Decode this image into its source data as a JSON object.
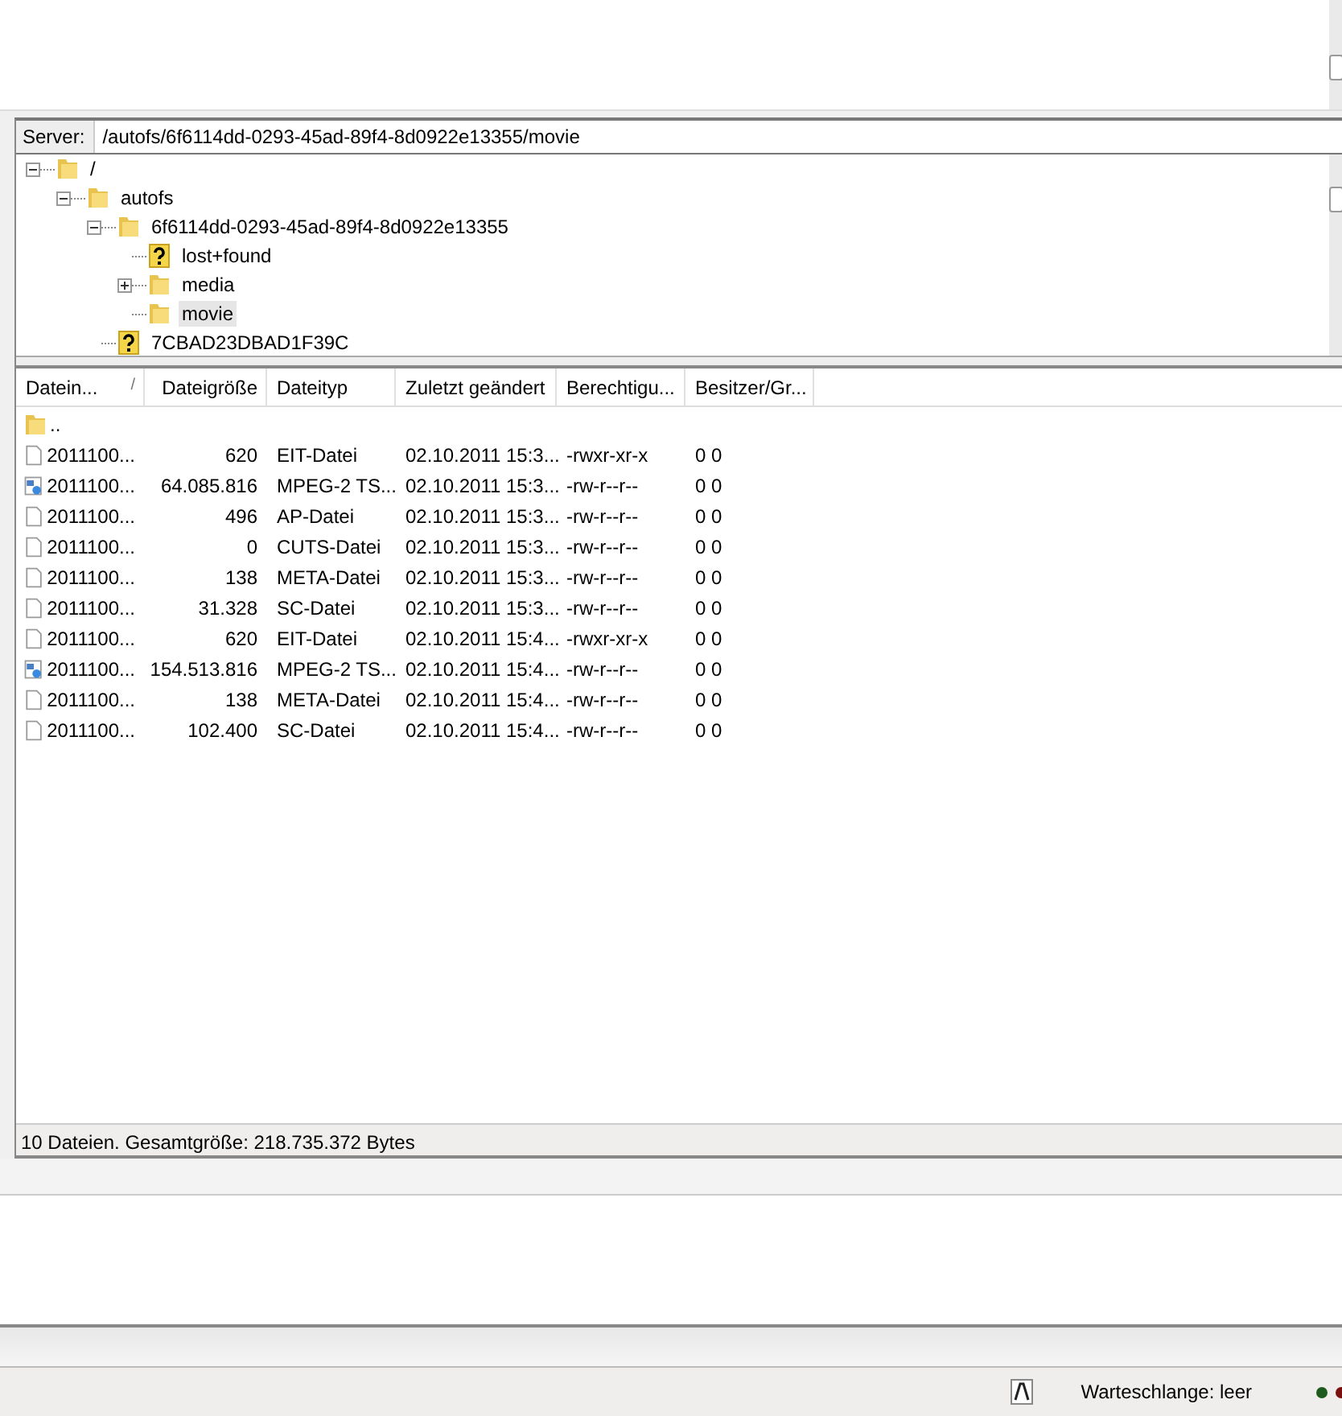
{
  "server_bar": {
    "label": "Server:",
    "path": "/autofs/6f6114dd-0293-45ad-89f4-8d0922e13355/movie"
  },
  "tree": [
    {
      "label": "/",
      "kind": "folder",
      "expanded": true,
      "selected": false,
      "children": [
        {
          "label": "autofs",
          "kind": "folder",
          "expanded": true,
          "selected": false,
          "children": [
            {
              "label": "6f6114dd-0293-45ad-89f4-8d0922e13355",
              "kind": "folder",
              "expanded": true,
              "selected": false,
              "children": [
                {
                  "label": "lost+found",
                  "kind": "unknown",
                  "selected": false
                },
                {
                  "label": "media",
                  "kind": "folder",
                  "expanded": false,
                  "selected": false
                },
                {
                  "label": "movie",
                  "kind": "folder",
                  "selected": true
                }
              ]
            },
            {
              "label": "7CBAD23DBAD1F39C",
              "kind": "unknown",
              "selected": false
            }
          ]
        }
      ]
    }
  ],
  "table": {
    "columns": [
      {
        "label": "Datein...",
        "sort": "/"
      },
      {
        "label": "Dateigröße"
      },
      {
        "label": "Dateityp"
      },
      {
        "label": "Zuletzt geändert"
      },
      {
        "label": "Berechtigu..."
      },
      {
        "label": "Besitzer/Gr..."
      }
    ],
    "rows": [
      {
        "kind": "folder",
        "cells": [
          ".."
        ]
      },
      {
        "kind": "file",
        "cells": [
          "2011100...",
          "620",
          "EIT-Datei",
          "02.10.2011 15:3...",
          "-rwxr-xr-x",
          "0 0"
        ]
      },
      {
        "kind": "video",
        "cells": [
          "2011100...",
          "64.085.816",
          "MPEG-2 TS...",
          "02.10.2011 15:3...",
          "-rw-r--r--",
          "0 0"
        ]
      },
      {
        "kind": "file",
        "cells": [
          "2011100...",
          "496",
          "AP-Datei",
          "02.10.2011 15:3...",
          "-rw-r--r--",
          "0 0"
        ]
      },
      {
        "kind": "file",
        "cells": [
          "2011100...",
          "0",
          "CUTS-Datei",
          "02.10.2011 15:3...",
          "-rw-r--r--",
          "0 0"
        ]
      },
      {
        "kind": "file",
        "cells": [
          "2011100...",
          "138",
          "META-Datei",
          "02.10.2011 15:3...",
          "-rw-r--r--",
          "0 0"
        ]
      },
      {
        "kind": "file",
        "cells": [
          "2011100...",
          "31.328",
          "SC-Datei",
          "02.10.2011 15:3...",
          "-rw-r--r--",
          "0 0"
        ]
      },
      {
        "kind": "file",
        "cells": [
          "2011100...",
          "620",
          "EIT-Datei",
          "02.10.2011 15:4...",
          "-rwxr-xr-x",
          "0 0"
        ]
      },
      {
        "kind": "video",
        "cells": [
          "2011100...",
          "154.513.816",
          "MPEG-2 TS...",
          "02.10.2011 15:4...",
          "-rw-r--r--",
          "0 0"
        ]
      },
      {
        "kind": "file",
        "cells": [
          "2011100...",
          "138",
          "META-Datei",
          "02.10.2011 15:4...",
          "-rw-r--r--",
          "0 0"
        ]
      },
      {
        "kind": "file",
        "cells": [
          "2011100...",
          "102.400",
          "SC-Datei",
          "02.10.2011 15:4...",
          "-rw-r--r--",
          "0 0"
        ]
      }
    ]
  },
  "list_status": "10 Dateien. Gesamtgröße: 218.735.372 Bytes",
  "status_bar": {
    "queue": "Warteschlange: leer"
  }
}
